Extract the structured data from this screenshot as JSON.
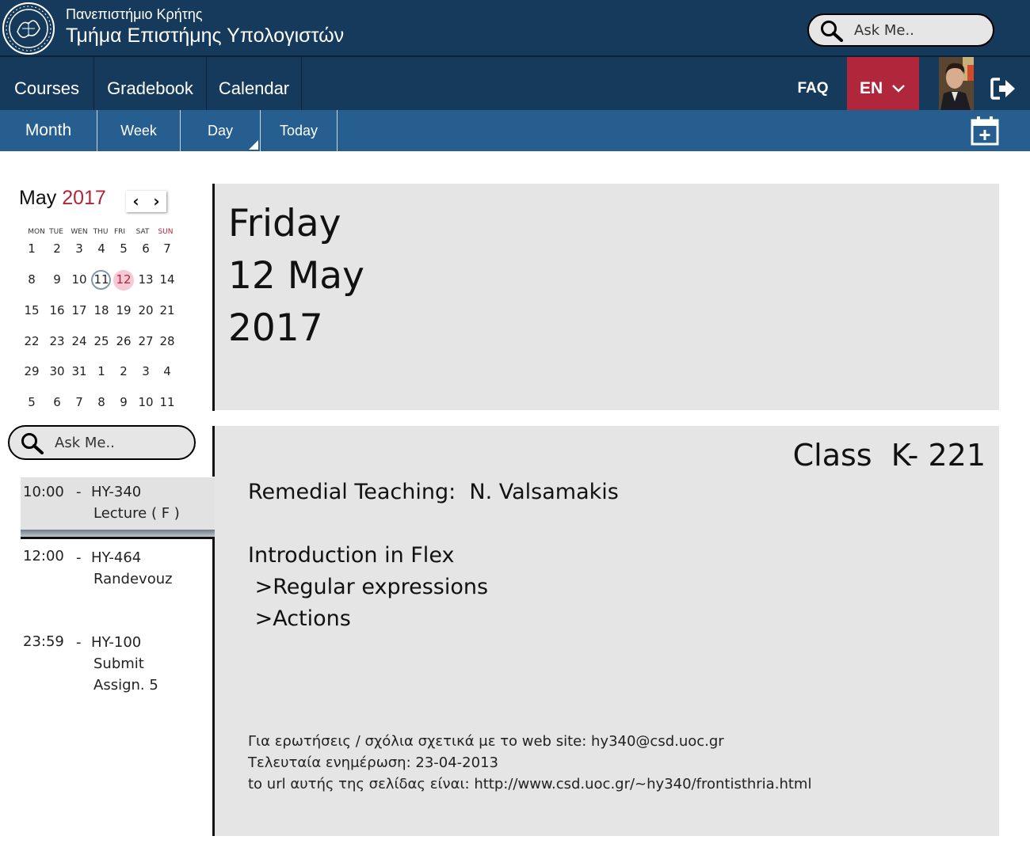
{
  "header": {
    "university": "Πανεπιστήμιο Κρήτης",
    "department": "Τμήμα Επιστήμης Υπολογιστών",
    "search_placeholder": "Ask Me.."
  },
  "nav": {
    "items": [
      "Courses",
      "Gradebook",
      "Calendar"
    ],
    "faq": "FAQ",
    "language": "EN"
  },
  "subnav": {
    "items": [
      "Month",
      "Week",
      "Day",
      "Today"
    ]
  },
  "mini_calendar": {
    "month": "May",
    "year": "2017",
    "weekdays": [
      "MON",
      "TUE",
      "WEN",
      "THU",
      "FRI",
      "SAT",
      "SUN"
    ],
    "weeks": [
      [
        "1",
        "2",
        "3",
        "4",
        "5",
        "6",
        "7"
      ],
      [
        "8",
        "9",
        "10",
        "11",
        "12",
        "13",
        "14"
      ],
      [
        "15",
        "16",
        "17",
        "18",
        "19",
        "20",
        "21"
      ],
      [
        "22",
        "23",
        "24",
        "25",
        "26",
        "27",
        "28"
      ],
      [
        "29",
        "30",
        "31",
        "1",
        "2",
        "3",
        "4"
      ],
      [
        "5",
        "6",
        "7",
        "8",
        "9",
        "10",
        "11"
      ]
    ],
    "today": "11",
    "selected": "12"
  },
  "side_search": {
    "placeholder": "Ask Me.."
  },
  "events": [
    {
      "time": "10:00",
      "sep": "-",
      "course": "HY-340",
      "detail": [
        "Lecture ( F )"
      ]
    },
    {
      "time": "12:00",
      "sep": "-",
      "course": "HY-464",
      "detail": [
        "Randevouz"
      ]
    },
    {
      "time": "23:59",
      "sep": "-",
      "course": "HY-100",
      "detail": [
        "Submit",
        "Assign. 5"
      ]
    }
  ],
  "day_header": {
    "weekday": "Friday",
    "date": "12 May",
    "year": "2017"
  },
  "details": {
    "location": "Class  K- 221",
    "teaching": "Remedial Teaching:  N. Valsamakis",
    "topic": "Introduction in Flex",
    "subtopics": [
      " >Regular expressions",
      " >Actions"
    ],
    "footer": [
      "Για ερωτήσεις / σχόλια σχετικά με το web site: hy340@csd.uoc.gr",
      "Τελευταία ενημέρωση: 23-04-2013",
      "to url αυτής της σελίδας είναι: http://www.csd.uoc.gr/~hy340/frontisthria.html"
    ]
  },
  "colors": {
    "navy": "#163a5c",
    "blue": "#255e8f",
    "accent_red": "#b0263a",
    "panel_gray": "#e5e5e5"
  },
  "icons": [
    "university-seal-icon",
    "search-icon",
    "chevron-down-icon",
    "logout-icon",
    "calendar-add-icon",
    "chevron-left-icon",
    "chevron-right-icon"
  ]
}
